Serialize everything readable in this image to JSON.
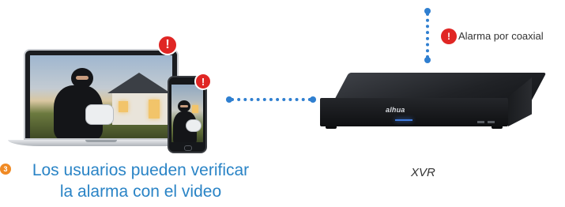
{
  "alarm": {
    "label": "Alarma por coaxial",
    "badge_symbol": "!"
  },
  "laptop_alert": {
    "badge_symbol": "!"
  },
  "phone_alert": {
    "badge_symbol": "!"
  },
  "device": {
    "brand": "alhua",
    "label": "XVR"
  },
  "step": {
    "number": "3",
    "text_line1": "Los usuarios pueden verificar",
    "text_line2": "la alarma con el video"
  },
  "colors": {
    "accent_blue": "#2a84c6",
    "connector_blue": "#2f7fd0",
    "alert_red": "#e02624",
    "step_orange": "#f08a24"
  },
  "icons": [
    "laptop-icon",
    "smartphone-icon",
    "alert-icon",
    "xvr-recorder-icon"
  ]
}
